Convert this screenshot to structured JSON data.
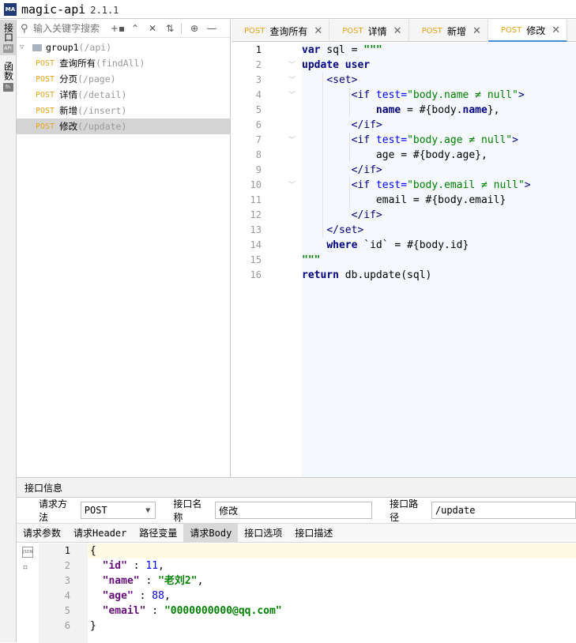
{
  "app": {
    "logo_text": "MA",
    "title": "magic-api",
    "version": "2.1.1"
  },
  "left_strip": {
    "tabs": [
      {
        "label": "接口",
        "badge": "API",
        "active": true
      },
      {
        "label": "函数",
        "badge": "fn",
        "active": false
      }
    ]
  },
  "sidebar": {
    "search_placeholder": "输入关键字搜索",
    "toolbar_icons": [
      "add-icon",
      "expand-collapse-icon",
      "collapse-all-icon",
      "sort-icon",
      "target-icon",
      "minimize-icon"
    ],
    "group": {
      "name": "group1",
      "path": "(/api)"
    },
    "items": [
      {
        "method": "POST",
        "name": "查询所有",
        "path": "(findAll)",
        "selected": false
      },
      {
        "method": "POST",
        "name": "分页",
        "path": "(/page)",
        "selected": false
      },
      {
        "method": "POST",
        "name": "详情",
        "path": "(/detail)",
        "selected": false
      },
      {
        "method": "POST",
        "name": "新增",
        "path": "(/insert)",
        "selected": false
      },
      {
        "method": "POST",
        "name": "修改",
        "path": "(/update)",
        "selected": true
      }
    ]
  },
  "editor": {
    "tabs": [
      {
        "method": "POST",
        "name": "查询所有",
        "active": false
      },
      {
        "method": "POST",
        "name": "详情",
        "active": false
      },
      {
        "method": "POST",
        "name": "新增",
        "active": false
      },
      {
        "method": "POST",
        "name": "修改",
        "active": true
      }
    ],
    "current_line": 1,
    "lines": [
      "1",
      "2",
      "3",
      "4",
      "5",
      "6",
      "7",
      "8",
      "9",
      "10",
      "11",
      "12",
      "13",
      "14",
      "15",
      "16"
    ]
  },
  "bottom": {
    "header": "接口信息",
    "method_label": "请求方法",
    "method_value": "POST",
    "name_label": "接口名称",
    "name_value": "修改",
    "path_label": "接口路径",
    "path_value": "/update",
    "subtabs": [
      "请求参数",
      "请求Header",
      "路径变量",
      "请求Body",
      "接口选项",
      "接口描述"
    ],
    "active_subtab": "请求Body",
    "json_lines": [
      "1",
      "2",
      "3",
      "4",
      "5",
      "6"
    ],
    "body": {
      "id_key": "\"id\"",
      "id_value": "11",
      "name_key": "\"name\"",
      "name_value": "\"老刘2\"",
      "age_key": "\"age\"",
      "age_value": "88",
      "email_key": "\"email\"",
      "email_value": "\"0000000000@qq.com\""
    }
  }
}
